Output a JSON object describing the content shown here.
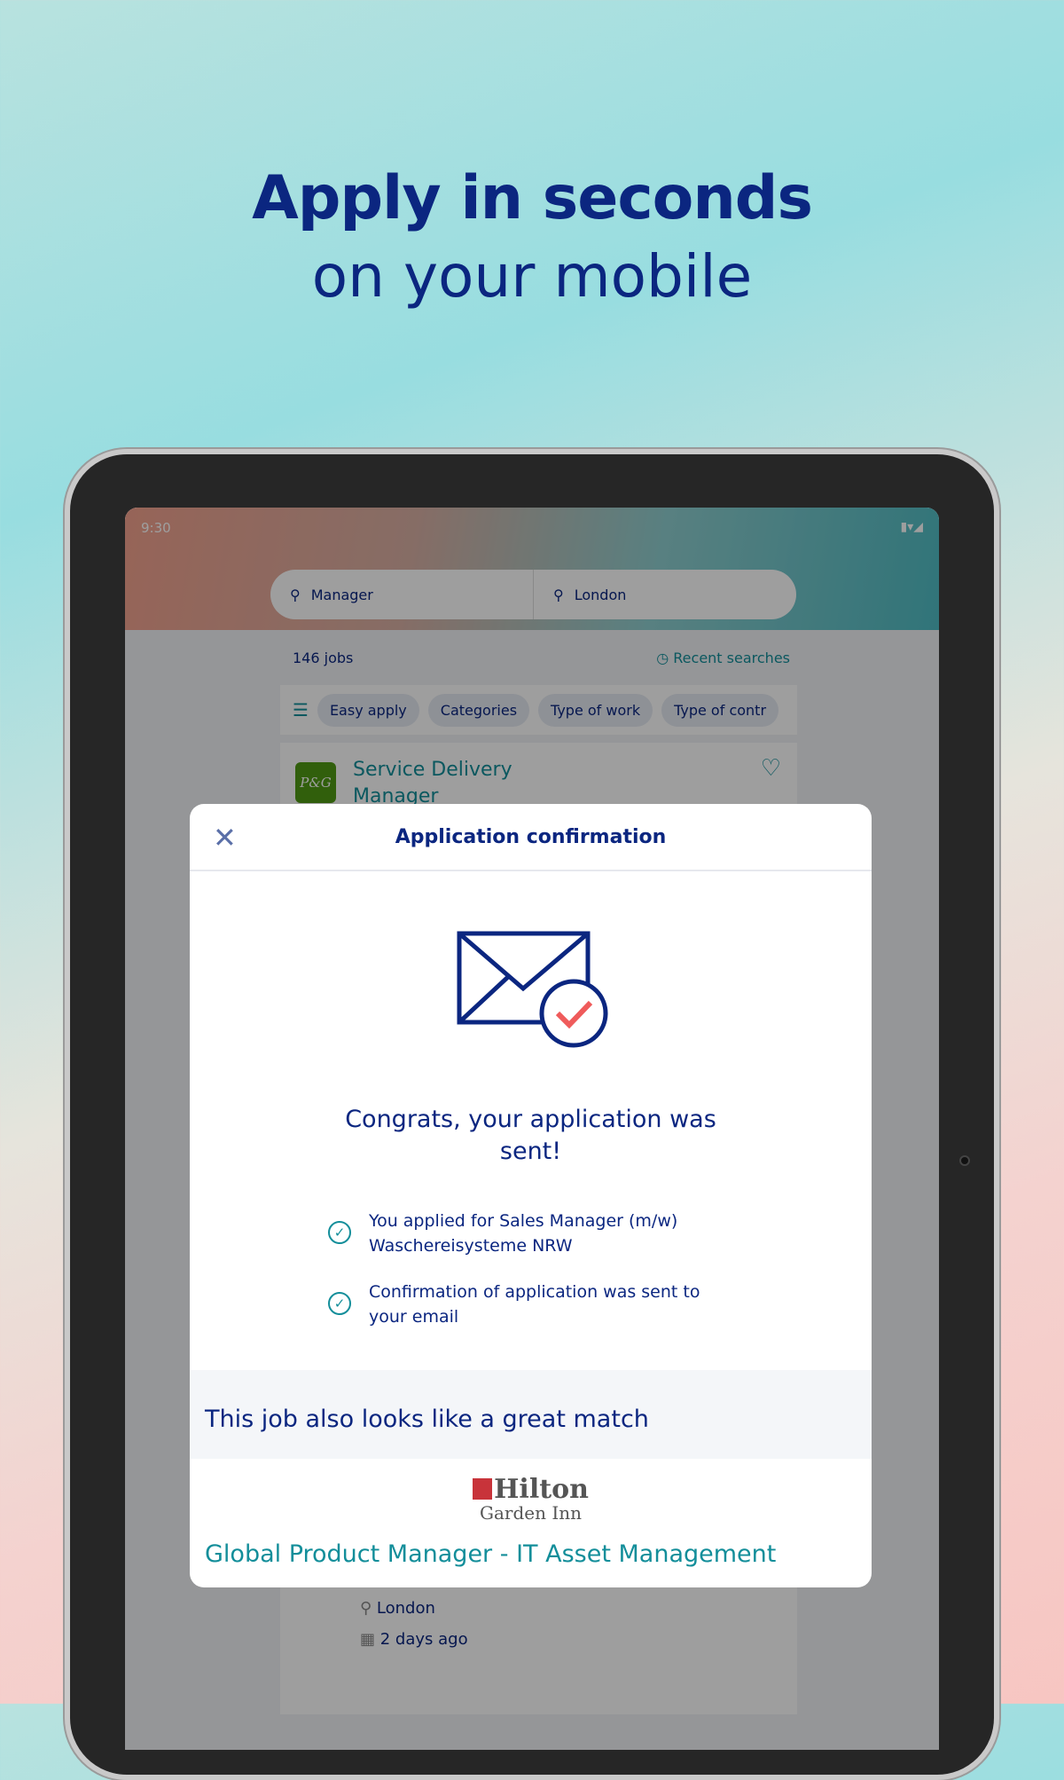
{
  "hero": {
    "line1": "Apply in seconds",
    "line2": "on your mobile"
  },
  "status": {
    "time": "9:30"
  },
  "search": {
    "what": "Manager",
    "where": "London"
  },
  "results": {
    "count": "146 jobs",
    "recent": "Recent searches"
  },
  "filters": [
    "Easy apply",
    "Categories",
    "Type of work",
    "Type of contr"
  ],
  "job": {
    "logo": "P&G",
    "title_l1": "Service Delivery",
    "title_l2": "Manager"
  },
  "job2": {
    "location": "London",
    "posted": "2 days ago"
  },
  "modal": {
    "title": "Application confirmation",
    "congrats_l1": "Congrats, your application was",
    "congrats_l2": "sent!",
    "items": [
      {
        "l1": "You applied for Sales Manager (m/w)",
        "l2": "Waschereisysteme NRW"
      },
      {
        "l1": "Confirmation of application was sent to",
        "l2": "your email"
      }
    ],
    "match_heading": "This job also looks like a great match",
    "match_logo": "Hilton Garden Inn",
    "match_job": "Global Product Manager - IT Asset Management"
  },
  "colors": {
    "navy": "#0b2680",
    "teal": "#138e9a"
  }
}
